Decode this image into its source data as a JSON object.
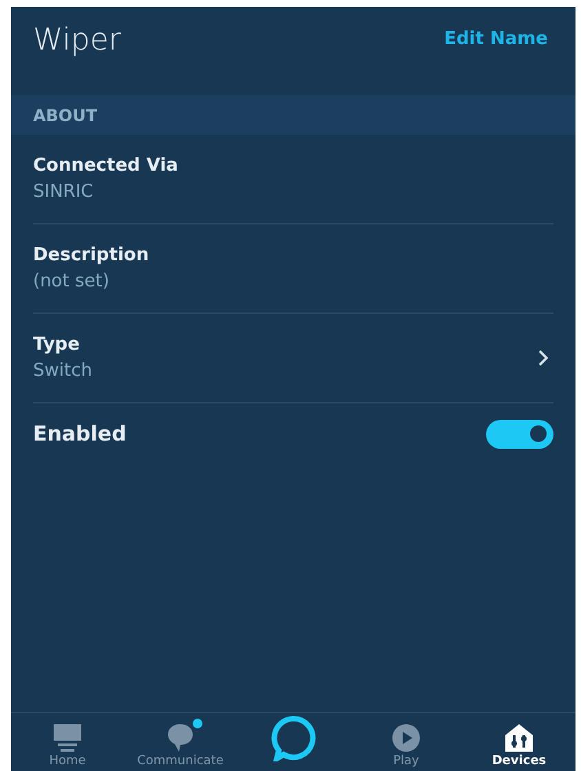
{
  "header": {
    "title": "Wiper",
    "action": "Edit Name"
  },
  "section": {
    "title": "ABOUT"
  },
  "rows": [
    {
      "kind": "info",
      "label": "Connected Via",
      "value": "SINRIC"
    },
    {
      "kind": "info",
      "label": "Description",
      "value": "(not set)"
    },
    {
      "kind": "link",
      "label": "Type",
      "value": "Switch"
    },
    {
      "kind": "toggle",
      "label": "Enabled",
      "on": true
    }
  ],
  "nav": [
    {
      "kind": "home",
      "label": "Home",
      "selected": false,
      "badge": false
    },
    {
      "kind": "chat",
      "label": "Communicate",
      "selected": false,
      "badge": true
    },
    {
      "kind": "alexa",
      "selected": false,
      "badge": false
    },
    {
      "kind": "play",
      "label": "Play",
      "selected": false,
      "badge": false
    },
    {
      "kind": "devices",
      "label": "Devices",
      "selected": true,
      "badge": false
    }
  ]
}
